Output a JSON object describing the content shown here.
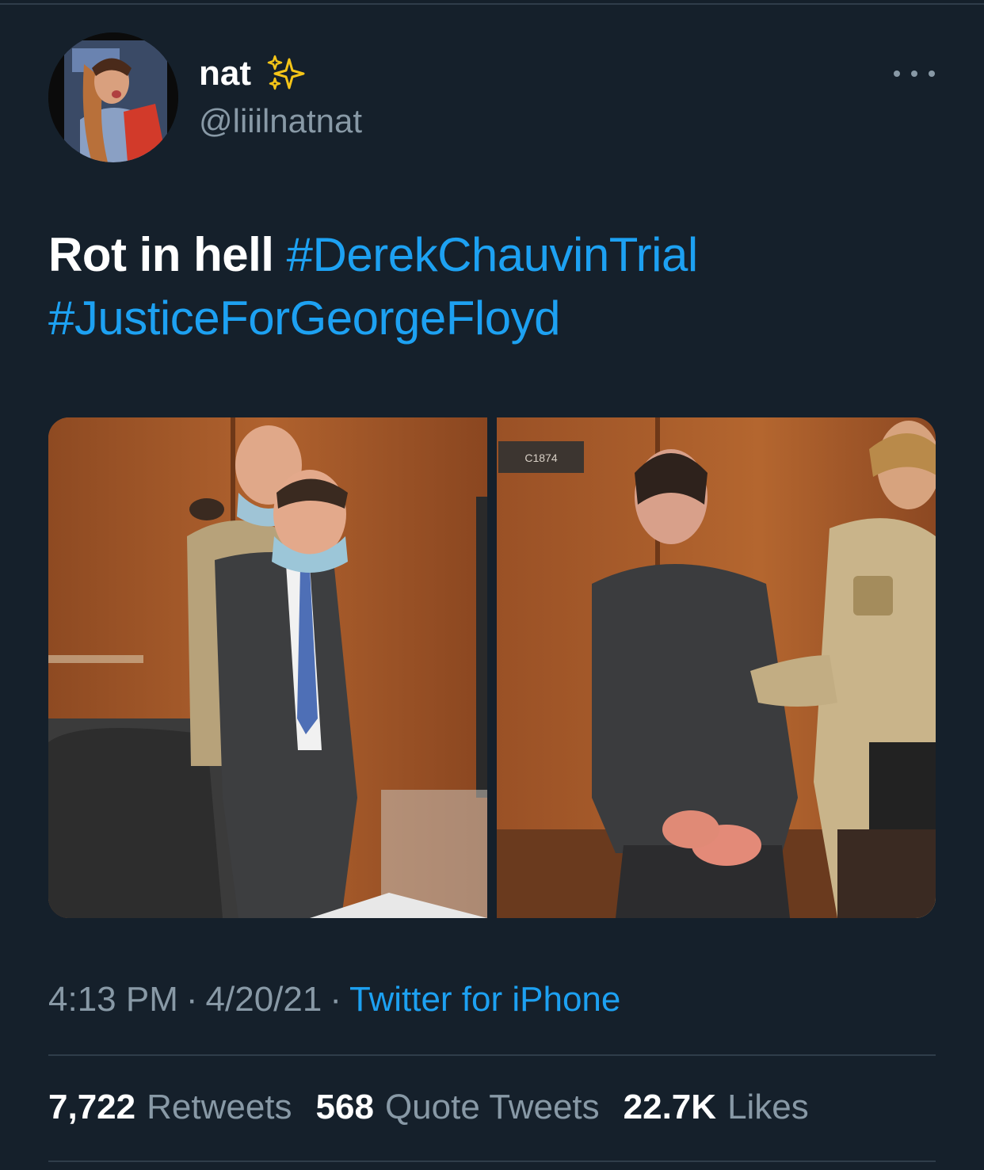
{
  "tweet": {
    "author": {
      "display_name": "nat",
      "emoji_icon": "sparkles-icon",
      "handle": "@liiilnatnat"
    },
    "text": {
      "plain": "Rot in hell",
      "hashtags": [
        "#DerekChauvinTrial",
        "#JusticeForGeorgeFloyd"
      ]
    },
    "media": {
      "photos": [
        {
          "icon": "courtroom-photo-1"
        },
        {
          "icon": "courtroom-photo-2",
          "door_sign": "C1874"
        }
      ]
    },
    "meta": {
      "time": "4:13 PM",
      "separator": "·",
      "date": "4/20/21",
      "source": "Twitter for iPhone"
    },
    "stats": {
      "retweets": {
        "count": "7,722",
        "label": "Retweets"
      },
      "quote_tweets": {
        "count": "568",
        "label": "Quote Tweets"
      },
      "likes": {
        "count": "22.7K",
        "label": "Likes"
      }
    },
    "colors": {
      "background": "#15202b",
      "accent": "#1da1f2",
      "secondary_text": "#8899a6",
      "divider": "#2f3d4a"
    }
  }
}
